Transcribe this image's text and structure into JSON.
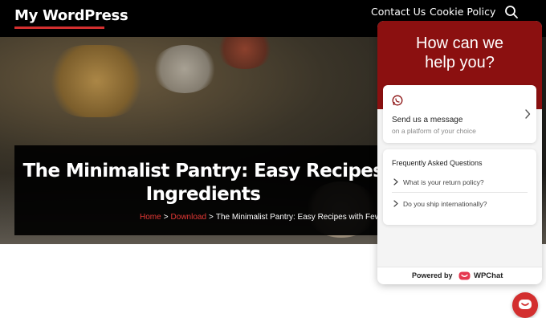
{
  "header": {
    "site_title": "My WordPress",
    "nav": [
      "Contact Us",
      "Cookie Policy"
    ],
    "search_icon": "search-icon"
  },
  "hero": {
    "title_line1": "The Minimalist Pantry: Easy Recipes",
    "title_line2": "Ingredients",
    "breadcrumb": {
      "home": "Home",
      "sep1": ">",
      "download": "Download",
      "sep2": ">",
      "current": "The Minimalist Pantry: Easy Recipes with Few Ingredients"
    }
  },
  "chat": {
    "heading_line1": "How can we",
    "heading_line2": "help you?",
    "message_card": {
      "icon": "whatsapp-icon",
      "title": "Send us a message",
      "subtitle": "on a platform of your choice"
    },
    "faq": {
      "title": "Frequently Asked Questions",
      "items": [
        "What is your return policy?",
        "Do you ship internationally?"
      ]
    },
    "powered_by": "Powered by",
    "brand": "WPChat"
  },
  "colors": {
    "header_bg": "#000000",
    "accent_red": "#d32f2f",
    "chat_header": "#8b1010"
  }
}
